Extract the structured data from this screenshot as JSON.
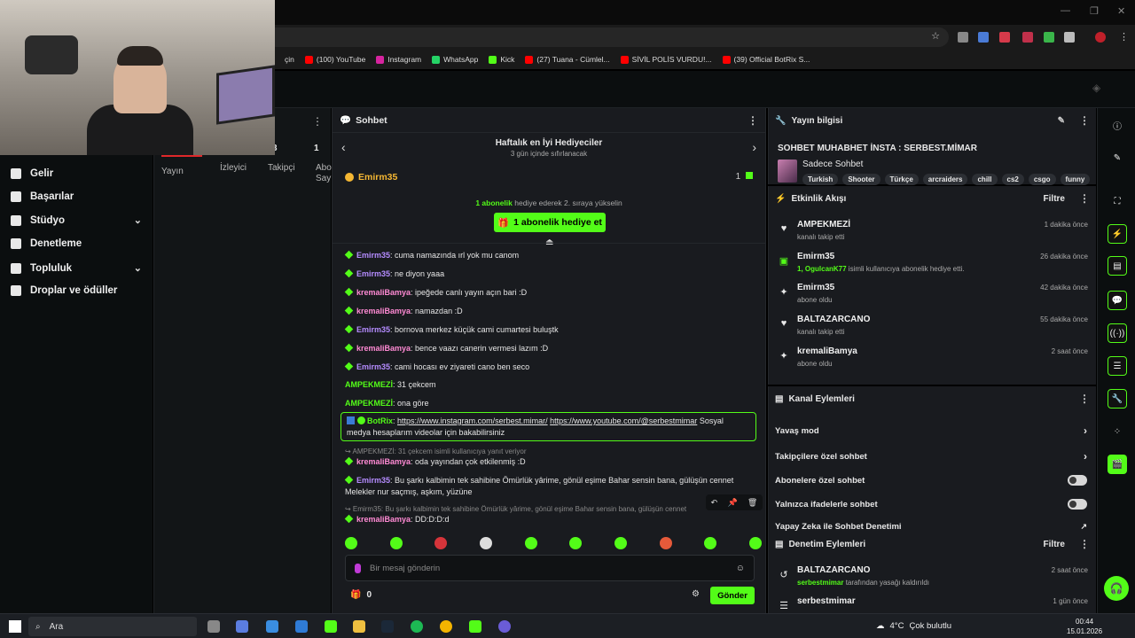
{
  "window": {
    "minimize": "—",
    "restore": "❐",
    "close": "✕"
  },
  "bookmarks": [
    {
      "label": "çin",
      "color": "#1a1a1a"
    },
    {
      "label": "(100) YouTube",
      "color": "#ff0000"
    },
    {
      "label": "Instagram",
      "color": "#d6249f"
    },
    {
      "label": "WhatsApp",
      "color": "#25d366"
    },
    {
      "label": "Kick",
      "color": "#53fc18"
    },
    {
      "label": "(27) Tuana - Cümlel...",
      "color": "#ff0000"
    },
    {
      "label": "SİVİL POLİS VURDU!...",
      "color": "#ff0000"
    },
    {
      "label": "(39) Official BotRix S...",
      "color": "#ff0000"
    }
  ],
  "sidebar": {
    "items": [
      {
        "label": "Gelir",
        "chevron": false
      },
      {
        "label": "Başarılar",
        "chevron": false
      },
      {
        "label": "Stüdyo",
        "chevron": true
      },
      {
        "label": "Denetleme",
        "chevron": false
      },
      {
        "label": "Topluluk",
        "chevron": true
      },
      {
        "label": "Droplar ve ödüller",
        "chevron": false
      }
    ],
    "chevron": "⌄"
  },
  "stats": {
    "tabs": [
      "Yayın",
      "İzleyici",
      "Takipçi",
      "Abo Sayı"
    ],
    "number": "1",
    "number_partial": "3"
  },
  "chat": {
    "header": "Sohbet",
    "gifters_title": "Haftalık en İyi Hediyeciler",
    "gifters_subtitle": "3 gün içinde sıfırlanacak",
    "top_gifter": "Emirm35",
    "top_gifter_count": "1",
    "cta_strong": "1 abonelik",
    "cta_rest": " hediye ederek 2. sıraya yükselin",
    "gift_button": "1 abonelik hediye et",
    "messages": [
      {
        "user": "Emirm35",
        "color": "purple",
        "text": ": cuma namazında ırl yok mu canom"
      },
      {
        "user": "Emirm35",
        "color": "purple",
        "text": ": ne diyon yaaa"
      },
      {
        "user": "kremaliBamya",
        "color": "pink",
        "text": ": ipeğede canlı yayın açın bari :D"
      },
      {
        "user": "kremaliBamya",
        "color": "pink",
        "text": ": namazdan :D"
      },
      {
        "user": "Emirm35",
        "color": "purple",
        "text": ": bornova merkez küçük cami cumartesi buluştk"
      },
      {
        "user": "kremaliBamya",
        "color": "pink",
        "text": ": bence vaazı canerin vermesi lazım :D"
      },
      {
        "user": "Emirm35",
        "color": "purple",
        "text": ": cami hocası ev ziyareti cano ben seco"
      },
      {
        "user": "AMPEKMEZİ",
        "color": "green",
        "text": ": 31 çekcem"
      },
      {
        "user": "AMPEKMEZİ",
        "color": "green",
        "text": ": ona göre"
      }
    ],
    "bot": {
      "user": "BotRix",
      "link1": "https://www.instagram.com/serbest.mimar/",
      "link2": "https://www.youtube.com/@serbestmimar",
      "text1": " Sosyal",
      "text2": "medya hesaplarım videolar için bakabilirsiniz"
    },
    "reply1": "↪ AMPEKMEZİ: 31 çekcem isimli kullanıcıya yanıt veriyor",
    "msg_after1": {
      "user": "kremaliBamya",
      "text": ": oda yayından çok etkilenmiş :D"
    },
    "msg_long": {
      "user": "Emirm35",
      "text": ": Bu şarkı kalbimin tek sahibine Ömürlük yârime, gönül eşime Bahar sensin bana, gülüşün cennet",
      "text2": "Melekler nur saçmış, aşkım, yüzüne"
    },
    "reply2": "↪ Emirm35: Bu şarkı kalbimin tek sahibine Ömürlük yârime, gönül eşime Bahar sensin bana, gülüşün cennet",
    "msg_last": {
      "user": "kremaliBamya",
      "text": ": DD:D:D:d"
    },
    "input_placeholder": "Bir mesaj gönderin",
    "points": "0",
    "send": "Gönder",
    "tools": [
      "↶",
      "📌",
      "🗑"
    ]
  },
  "stream_info": {
    "header": "Yayın bilgisi",
    "title": "SOHBET MUHABHET İNSTA : SERBEST.MİMAR",
    "category": "Sadece Sohbet",
    "tags": [
      "Turkish",
      "Shooter",
      "Türkçe",
      "arcraiders",
      "chill",
      "cs2",
      "csgo",
      "funny"
    ]
  },
  "activity": {
    "header": "Etkinlik Akışı",
    "filter": "Filtre",
    "items": [
      {
        "icon": "♥",
        "name": "AMPEKMEZİ",
        "sub": "kanalı takip etti",
        "time": "1 dakika önce"
      },
      {
        "icon": "▣",
        "name": "Emirm35",
        "sub_strong": "1, OgulcanK77",
        "sub": " isimli kullanıcıya abonelik hediye etti.",
        "time": "26 dakika önce"
      },
      {
        "icon": "✦",
        "name": "Emirm35",
        "sub": "abone oldu",
        "time": "42 dakika önce"
      },
      {
        "icon": "♥",
        "name": "BALTAZARCANO",
        "sub": "kanalı takip etti",
        "time": "55 dakika önce"
      },
      {
        "icon": "✦",
        "name": "kremaliBamya",
        "sub": "abone oldu",
        "time": "2 saat önce"
      }
    ]
  },
  "channel_actions": {
    "header": "Kanal Eylemleri",
    "rows": [
      {
        "label": "Yavaş mod",
        "type": "arrow"
      },
      {
        "label": "Takipçilere özel sohbet",
        "type": "arrow"
      },
      {
        "label": "Abonelere özel sohbet",
        "type": "toggle"
      },
      {
        "label": "Yalnızca ifadelerle sohbet",
        "type": "toggle"
      },
      {
        "label": "Yapay Zeka ile Sohbet Denetimi",
        "type": "link"
      }
    ]
  },
  "mod_actions": {
    "header": "Denetim Eylemleri",
    "filter": "Filtre",
    "items": [
      {
        "name": "BALTAZARCANO",
        "sub_strong": "serbestmimar",
        "sub": " tarafından yasağı kaldırıldı",
        "time": "2 saat önce"
      },
      {
        "name": "serbestmimar",
        "sub": "",
        "time": "1 gün önce"
      }
    ]
  },
  "taskbar": {
    "search": "Ara",
    "temp": "4°C",
    "weather": "Çok bulutlu",
    "time": "00:44",
    "date": "15.01.2026"
  },
  "colors": {
    "kick_green": "#53fc18",
    "gold": "#f5b733"
  }
}
